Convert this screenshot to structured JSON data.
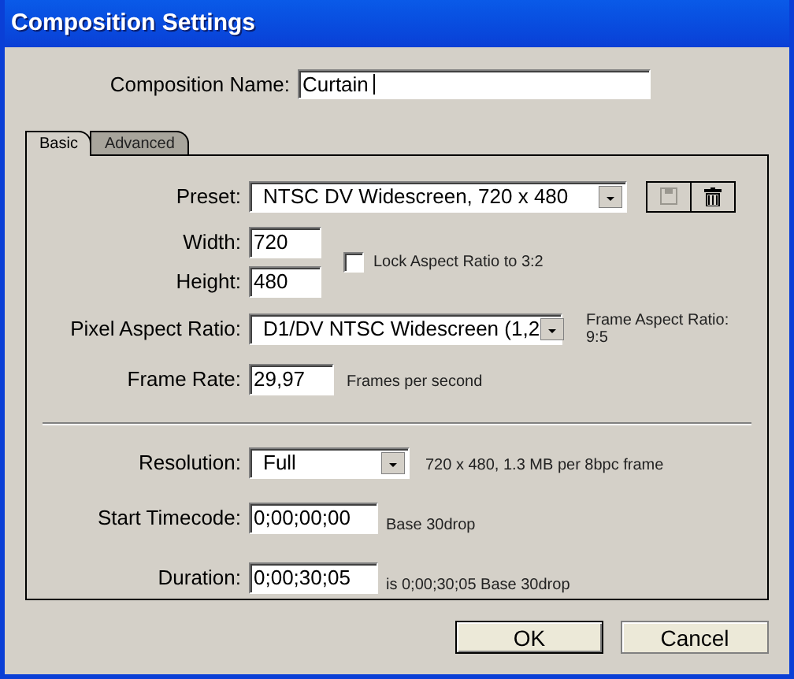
{
  "window": {
    "title": "Composition Settings"
  },
  "composition_name": {
    "label": "Composition Name:",
    "value": "Curtain",
    "focused": true
  },
  "tabs": [
    {
      "label": "Basic",
      "selected": true
    },
    {
      "label": "Advanced",
      "selected": false
    }
  ],
  "preset": {
    "label": "Preset:",
    "value": "NTSC DV Widescreen, 720 x 480",
    "save_disabled": true
  },
  "width": {
    "label": "Width:",
    "value": "720"
  },
  "height": {
    "label": "Height:",
    "value": "480"
  },
  "lock_aspect": {
    "label": "Lock Aspect Ratio to 3:2",
    "checked": false
  },
  "pixel_aspect_ratio": {
    "label": "Pixel Aspect Ratio:",
    "value": "D1/DV NTSC Widescreen (1,2",
    "note_lines": [
      "Frame Aspect Ratio:",
      "9:5"
    ]
  },
  "frame_rate": {
    "label": "Frame Rate:",
    "value": "29,97",
    "unit": "Frames per second"
  },
  "resolution": {
    "label": "Resolution:",
    "value": "Full",
    "info": "720 x 480, 1.3 MB per 8bpc frame"
  },
  "start_timecode": {
    "label": "Start Timecode:",
    "value": "0;00;00;00",
    "note": "Base 30drop"
  },
  "duration": {
    "label": "Duration:",
    "value": "0;00;30;05",
    "note": "is 0;00;30;05  Base 30drop"
  },
  "buttons": [
    {
      "label": "OK",
      "default": true
    },
    {
      "label": "Cancel",
      "default": false
    }
  ]
}
